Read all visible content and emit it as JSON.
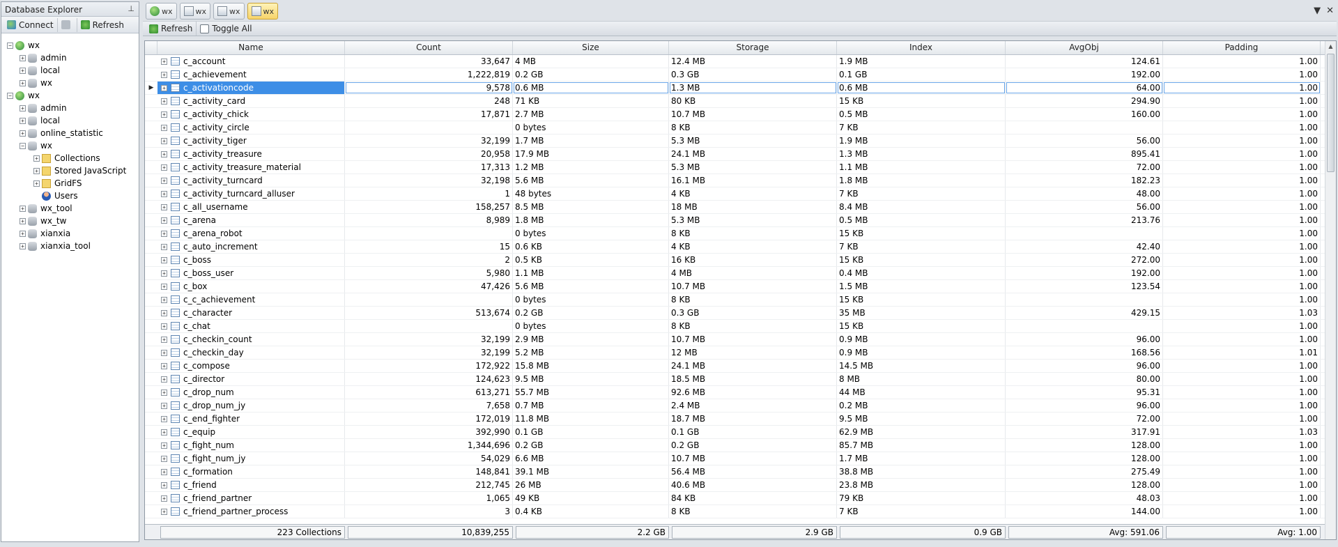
{
  "explorer": {
    "title": "Database Explorer",
    "pin_icon": "pin-icon",
    "connect_label": "Connect",
    "refresh_label": "Refresh",
    "tree": [
      {
        "label": "wx",
        "type": "server",
        "level": 0
      },
      {
        "label": "admin",
        "type": "db",
        "level": 1
      },
      {
        "label": "local",
        "type": "db",
        "level": 1
      },
      {
        "label": "wx",
        "type": "db",
        "level": 1
      },
      {
        "label": "wx",
        "type": "server",
        "level": 0
      },
      {
        "label": "admin",
        "type": "db",
        "level": 1
      },
      {
        "label": "local",
        "type": "db",
        "level": 1
      },
      {
        "label": "online_statistic",
        "type": "db",
        "level": 1
      },
      {
        "label": "wx",
        "type": "db",
        "level": 1
      },
      {
        "label": "Collections",
        "type": "folder",
        "level": 2
      },
      {
        "label": "Stored JavaScript",
        "type": "folder",
        "level": 2
      },
      {
        "label": "GridFS",
        "type": "folder",
        "level": 2
      },
      {
        "label": "Users",
        "type": "user",
        "level": 2
      },
      {
        "label": "wx_tool",
        "type": "db",
        "level": 1
      },
      {
        "label": "wx_tw",
        "type": "db",
        "level": 1
      },
      {
        "label": "xianxia",
        "type": "db",
        "level": 1
      },
      {
        "label": "xianxia_tool",
        "type": "db",
        "level": 1
      }
    ]
  },
  "tabs": [
    {
      "label": "wx",
      "icon": "server-icon",
      "active": false
    },
    {
      "label": "wx",
      "icon": "document-icon",
      "active": false
    },
    {
      "label": "wx",
      "icon": "document-icon",
      "active": false
    },
    {
      "label": "wx",
      "icon": "document-icon",
      "active": true
    }
  ],
  "toolbar": {
    "refresh_label": "Refresh",
    "toggle_label": "Toggle All"
  },
  "columns": [
    "Name",
    "Count",
    "Size",
    "Storage",
    "Index",
    "AvgObj",
    "Padding"
  ],
  "rows": [
    [
      "c_account",
      "33,647",
      "4 MB",
      "12.4 MB",
      "1.9 MB",
      "124.61",
      "1.00"
    ],
    [
      "c_achievement",
      "1,222,819",
      "0.2 GB",
      "0.3 GB",
      "0.1 GB",
      "192.00",
      "1.00"
    ],
    [
      "c_activationcode",
      "9,578",
      "0.6 MB",
      "1.3 MB",
      "0.6 MB",
      "64.00",
      "1.00"
    ],
    [
      "c_activity_card",
      "248",
      "71 KB",
      "80 KB",
      "15 KB",
      "294.90",
      "1.00"
    ],
    [
      "c_activity_chick",
      "17,871",
      "2.7 MB",
      "10.7 MB",
      "0.5 MB",
      "160.00",
      "1.00"
    ],
    [
      "c_activity_circle",
      "",
      "0 bytes",
      "8 KB",
      "7 KB",
      "",
      "1.00"
    ],
    [
      "c_activity_tiger",
      "32,199",
      "1.7 MB",
      "5.3 MB",
      "1.9 MB",
      "56.00",
      "1.00"
    ],
    [
      "c_activity_treasure",
      "20,958",
      "17.9 MB",
      "24.1 MB",
      "1.3 MB",
      "895.41",
      "1.00"
    ],
    [
      "c_activity_treasure_material",
      "17,313",
      "1.2 MB",
      "5.3 MB",
      "1.1 MB",
      "72.00",
      "1.00"
    ],
    [
      "c_activity_turncard",
      "32,198",
      "5.6 MB",
      "16.1 MB",
      "1.8 MB",
      "182.23",
      "1.00"
    ],
    [
      "c_activity_turncard_alluser",
      "1",
      "48 bytes",
      "4 KB",
      "7 KB",
      "48.00",
      "1.00"
    ],
    [
      "c_all_username",
      "158,257",
      "8.5 MB",
      "18 MB",
      "8.4 MB",
      "56.00",
      "1.00"
    ],
    [
      "c_arena",
      "8,989",
      "1.8 MB",
      "5.3 MB",
      "0.5 MB",
      "213.76",
      "1.00"
    ],
    [
      "c_arena_robot",
      "",
      "0 bytes",
      "8 KB",
      "15 KB",
      "",
      "1.00"
    ],
    [
      "c_auto_increment",
      "15",
      "0.6 KB",
      "4 KB",
      "7 KB",
      "42.40",
      "1.00"
    ],
    [
      "c_boss",
      "2",
      "0.5 KB",
      "16 KB",
      "15 KB",
      "272.00",
      "1.00"
    ],
    [
      "c_boss_user",
      "5,980",
      "1.1 MB",
      "4 MB",
      "0.4 MB",
      "192.00",
      "1.00"
    ],
    [
      "c_box",
      "47,426",
      "5.6 MB",
      "10.7 MB",
      "1.5 MB",
      "123.54",
      "1.00"
    ],
    [
      "c_c_achievement",
      "",
      "0 bytes",
      "8 KB",
      "15 KB",
      "",
      "1.00"
    ],
    [
      "c_character",
      "513,674",
      "0.2 GB",
      "0.3 GB",
      "35 MB",
      "429.15",
      "1.03"
    ],
    [
      "c_chat",
      "",
      "0 bytes",
      "8 KB",
      "15 KB",
      "",
      "1.00"
    ],
    [
      "c_checkin_count",
      "32,199",
      "2.9 MB",
      "10.7 MB",
      "0.9 MB",
      "96.00",
      "1.00"
    ],
    [
      "c_checkin_day",
      "32,199",
      "5.2 MB",
      "12 MB",
      "0.9 MB",
      "168.56",
      "1.01"
    ],
    [
      "c_compose",
      "172,922",
      "15.8 MB",
      "24.1 MB",
      "14.5 MB",
      "96.00",
      "1.00"
    ],
    [
      "c_director",
      "124,623",
      "9.5 MB",
      "18.5 MB",
      "8 MB",
      "80.00",
      "1.00"
    ],
    [
      "c_drop_num",
      "613,271",
      "55.7 MB",
      "92.6 MB",
      "44 MB",
      "95.31",
      "1.00"
    ],
    [
      "c_drop_num_jy",
      "7,658",
      "0.7 MB",
      "2.4 MB",
      "0.2 MB",
      "96.00",
      "1.00"
    ],
    [
      "c_end_fighter",
      "172,019",
      "11.8 MB",
      "18.7 MB",
      "9.5 MB",
      "72.00",
      "1.00"
    ],
    [
      "c_equip",
      "392,990",
      "0.1 GB",
      "0.1 GB",
      "62.9 MB",
      "317.91",
      "1.03"
    ],
    [
      "c_fight_num",
      "1,344,696",
      "0.2 GB",
      "0.2 GB",
      "85.7 MB",
      "128.00",
      "1.00"
    ],
    [
      "c_fight_num_jy",
      "54,029",
      "6.6 MB",
      "10.7 MB",
      "1.7 MB",
      "128.00",
      "1.00"
    ],
    [
      "c_formation",
      "148,841",
      "39.1 MB",
      "56.4 MB",
      "38.8 MB",
      "275.49",
      "1.00"
    ],
    [
      "c_friend",
      "212,745",
      "26 MB",
      "40.6 MB",
      "23.8 MB",
      "128.00",
      "1.00"
    ],
    [
      "c_friend_partner",
      "1,065",
      "49 KB",
      "84 KB",
      "79 KB",
      "48.03",
      "1.00"
    ],
    [
      "c_friend_partner_process",
      "3",
      "0.4 KB",
      "8 KB",
      "7 KB",
      "144.00",
      "1.00"
    ]
  ],
  "selected_row": 2,
  "footer": [
    "223 Collections",
    "10,839,255",
    "2.2 GB",
    "2.9 GB",
    "0.9 GB",
    "Avg: 591.06",
    "Avg: 1.00"
  ]
}
